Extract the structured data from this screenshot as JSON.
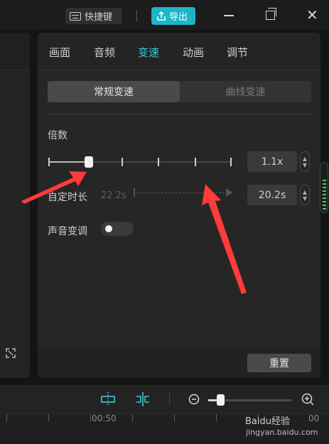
{
  "titlebar": {
    "shortcuts_label": "快捷键",
    "export_label": "导出"
  },
  "tabs": [
    "画面",
    "音频",
    "变速",
    "动画",
    "调节"
  ],
  "active_tab_index": 2,
  "speed_mode": {
    "normal_label": "常规变速",
    "curve_label": "曲线变速",
    "active": "常规变速"
  },
  "multiplier": {
    "label": "倍数",
    "value": "1.1x",
    "slider_fraction": 0.22
  },
  "custom_duration": {
    "label": "自定时长",
    "original": "22.2s",
    "value": "20.2s"
  },
  "voice_pitch": {
    "label": "声音变调",
    "enabled": false
  },
  "footer": {
    "reset_label": "重置"
  },
  "timeline": {
    "time_label": "00:50",
    "partial_label": "00",
    "zoom_fraction": 0.15
  },
  "watermark": {
    "brand": "Baidu经验",
    "url": "jingyan.baidu.com"
  },
  "colors": {
    "accent": "#39c7d6",
    "export_button": "#1fb5c9",
    "annotation_arrow": "#ff3b3b",
    "meter": "#3fd25c"
  },
  "icons": {
    "shortcuts": "keyboard-icon",
    "export": "export-icon",
    "minimize": "minimize-icon",
    "maximize": "maximize-icon",
    "close": "close-icon",
    "expand": "expand-icon",
    "split": "split-icon",
    "snap": "snap-icon",
    "zoom_out": "zoom-out-icon",
    "zoom_in": "zoom-in-icon"
  }
}
